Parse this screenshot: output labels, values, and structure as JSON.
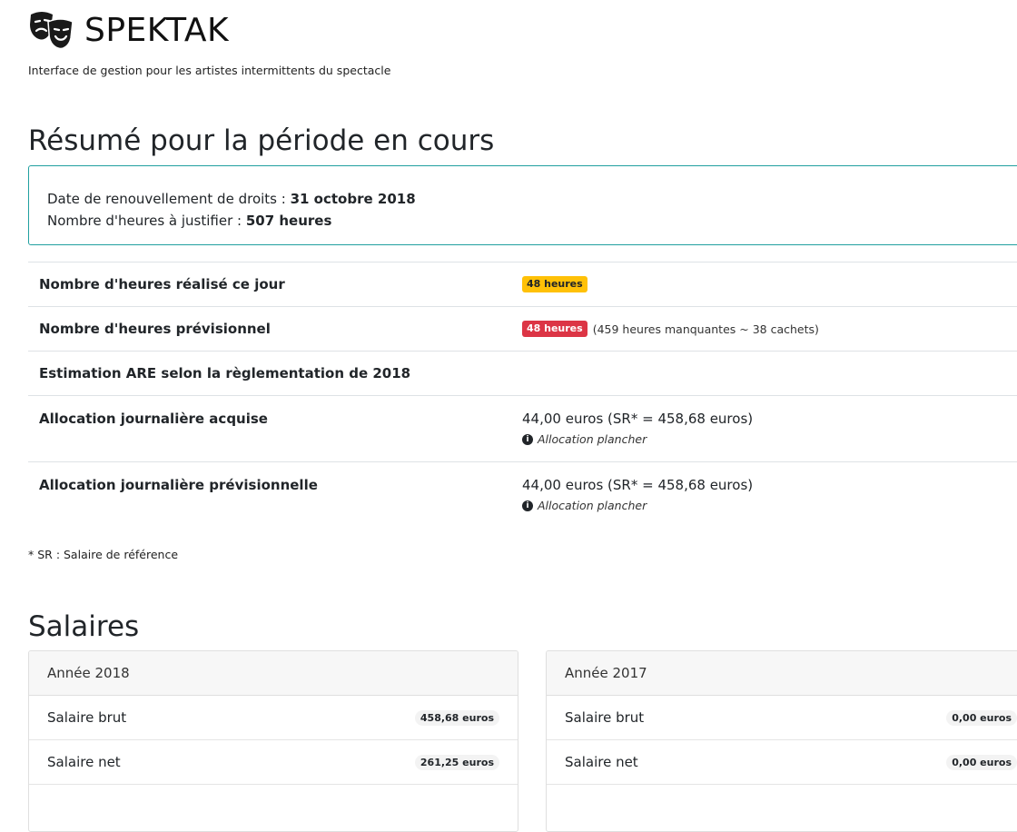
{
  "header": {
    "brand": "SPEKTAK",
    "tagline": "Interface de gestion pour les artistes intermittents du spectacle"
  },
  "summary": {
    "title": "Résumé pour la période en cours",
    "renewal_label": "Date de renouvellement de droits : ",
    "renewal_value": "31 octobre 2018",
    "hours_label": "Nombre d'heures à justifier : ",
    "hours_value": "507 heures"
  },
  "rows": {
    "today_label": "Nombre d'heures réalisé ce jour",
    "today_badge": "48 heures",
    "forecast_label": "Nombre d'heures prévisionnel",
    "forecast_badge": "48 heures",
    "forecast_missing": "(459 heures manquantes ~ 38 cachets)",
    "are_label": "Estimation ARE selon la règlementation de 2018",
    "acquired_label": "Allocation journalière acquise",
    "acquired_value": "44,00 euros (SR* = 458,68 euros)",
    "acquired_note": "Allocation plancher",
    "forecast_alloc_label": "Allocation journalière prévisionnelle",
    "forecast_alloc_value": "44,00 euros (SR* = 458,68 euros)",
    "forecast_alloc_note": "Allocation plancher"
  },
  "footnote": "* SR : Salaire de référence",
  "salaries": {
    "title": "Salaires",
    "cards": [
      {
        "year": "Année 2018",
        "gross_label": "Salaire brut",
        "gross": "458,68 euros",
        "net_label": "Salaire net",
        "net": "261,25 euros"
      },
      {
        "year": "Année 2017",
        "gross_label": "Salaire brut",
        "gross": "0,00 euros",
        "net_label": "Salaire net",
        "net": "0,00 euros"
      }
    ]
  },
  "colors": {
    "warning": "#ffc107",
    "danger": "#dc3545",
    "info_border": "#21a0a0"
  }
}
